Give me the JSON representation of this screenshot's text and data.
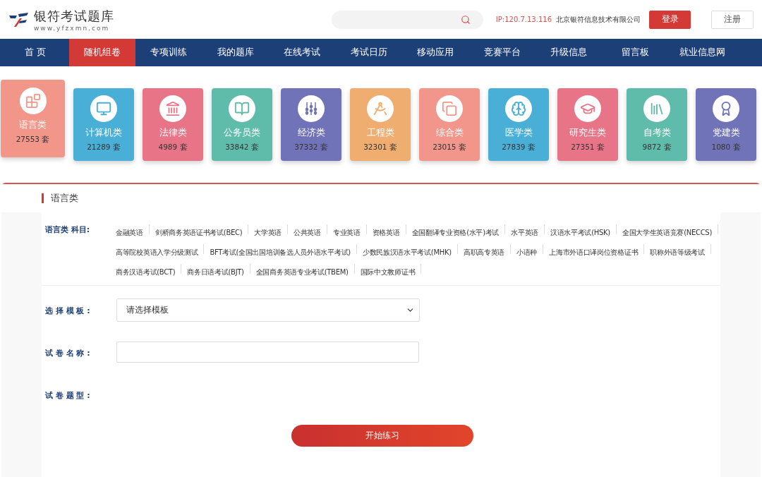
{
  "logo": {
    "name": "银符考试题库",
    "url": "www.yfzxmn.com"
  },
  "header": {
    "ip": "IP:120.7.13.116",
    "company": "北京银符信息技术有限公司",
    "login": "登录",
    "register": "注册"
  },
  "nav": [
    {
      "label": "首 页",
      "selected": false
    },
    {
      "label": "随机组卷",
      "selected": true
    },
    {
      "label": "专项训练",
      "selected": false
    },
    {
      "label": "我的题库",
      "selected": false
    },
    {
      "label": "在线考试",
      "selected": false
    },
    {
      "label": "考试日历",
      "selected": false
    },
    {
      "label": "移动应用",
      "selected": false
    },
    {
      "label": "竞赛平台",
      "selected": false
    },
    {
      "label": "升级信息",
      "selected": false
    },
    {
      "label": "留言板",
      "selected": false
    },
    {
      "label": "就业信息网",
      "selected": false
    }
  ],
  "categories": [
    {
      "kind": "blocks",
      "name": "语言类",
      "count": "27553 套",
      "color": "#f2968a",
      "selected": true
    },
    {
      "kind": "monitor",
      "name": "计算机类",
      "count": "21289 套",
      "color": "#4aafd6",
      "selected": false
    },
    {
      "kind": "court",
      "name": "法律类",
      "count": "4989 套",
      "color": "#e87487",
      "selected": false
    },
    {
      "kind": "book",
      "name": "公务员类",
      "count": "33842 套",
      "color": "#5fbcaa",
      "selected": false
    },
    {
      "kind": "abacus",
      "name": "经济类",
      "count": "37332 套",
      "color": "#7173b8",
      "selected": false
    },
    {
      "kind": "compass",
      "name": "工程类",
      "count": "32301 套",
      "color": "#f0ad70",
      "selected": false
    },
    {
      "kind": "copies",
      "name": "综合类",
      "count": "23015 套",
      "color": "#f2958a",
      "selected": false
    },
    {
      "kind": "brain",
      "name": "医学类",
      "count": "27839 套",
      "color": "#4aafd6",
      "selected": false
    },
    {
      "kind": "cap",
      "name": "研究生类",
      "count": "27351 套",
      "color": "#e87487",
      "selected": false
    },
    {
      "kind": "books",
      "name": "自考类",
      "count": "9872 套",
      "color": "#5fbcaa",
      "selected": false
    },
    {
      "kind": "award",
      "name": "党建类",
      "count": "1080 套",
      "color": "#7173b8",
      "selected": false
    }
  ],
  "section": {
    "title": "语言类",
    "subjects_label": "语言类 科目:",
    "subjects": [
      "金融英语",
      "剑桥商务英语证书考试(BEC)",
      "大学英语",
      "公共英语",
      "专业英语",
      "资格英语",
      "全国翻译专业资格(水平)考试",
      "水平英语",
      "汉语水平考试(HSK)",
      "全国大学生英语竞赛(NECCS)",
      "高等院校英语入学分级测试",
      "BFT考试(全国出国培训备选人员外语水平考试)",
      "少数民族汉语水平考试(MHK)",
      "高职高专英语",
      "小语种",
      "上海市外语口译岗位资格证书",
      "职称外语等级考试",
      "商务汉语考试(BCT)",
      "商务日语考试(BJT)",
      "全国商务英语专业考试(TBEM)",
      "国际中文教师证书"
    ],
    "template_label": "选 择 模 板 :",
    "template_value": "请选择模板",
    "name_label": "试 卷 名 称 :",
    "type_label": "试 卷 题 型 :",
    "start": "开始练习"
  }
}
